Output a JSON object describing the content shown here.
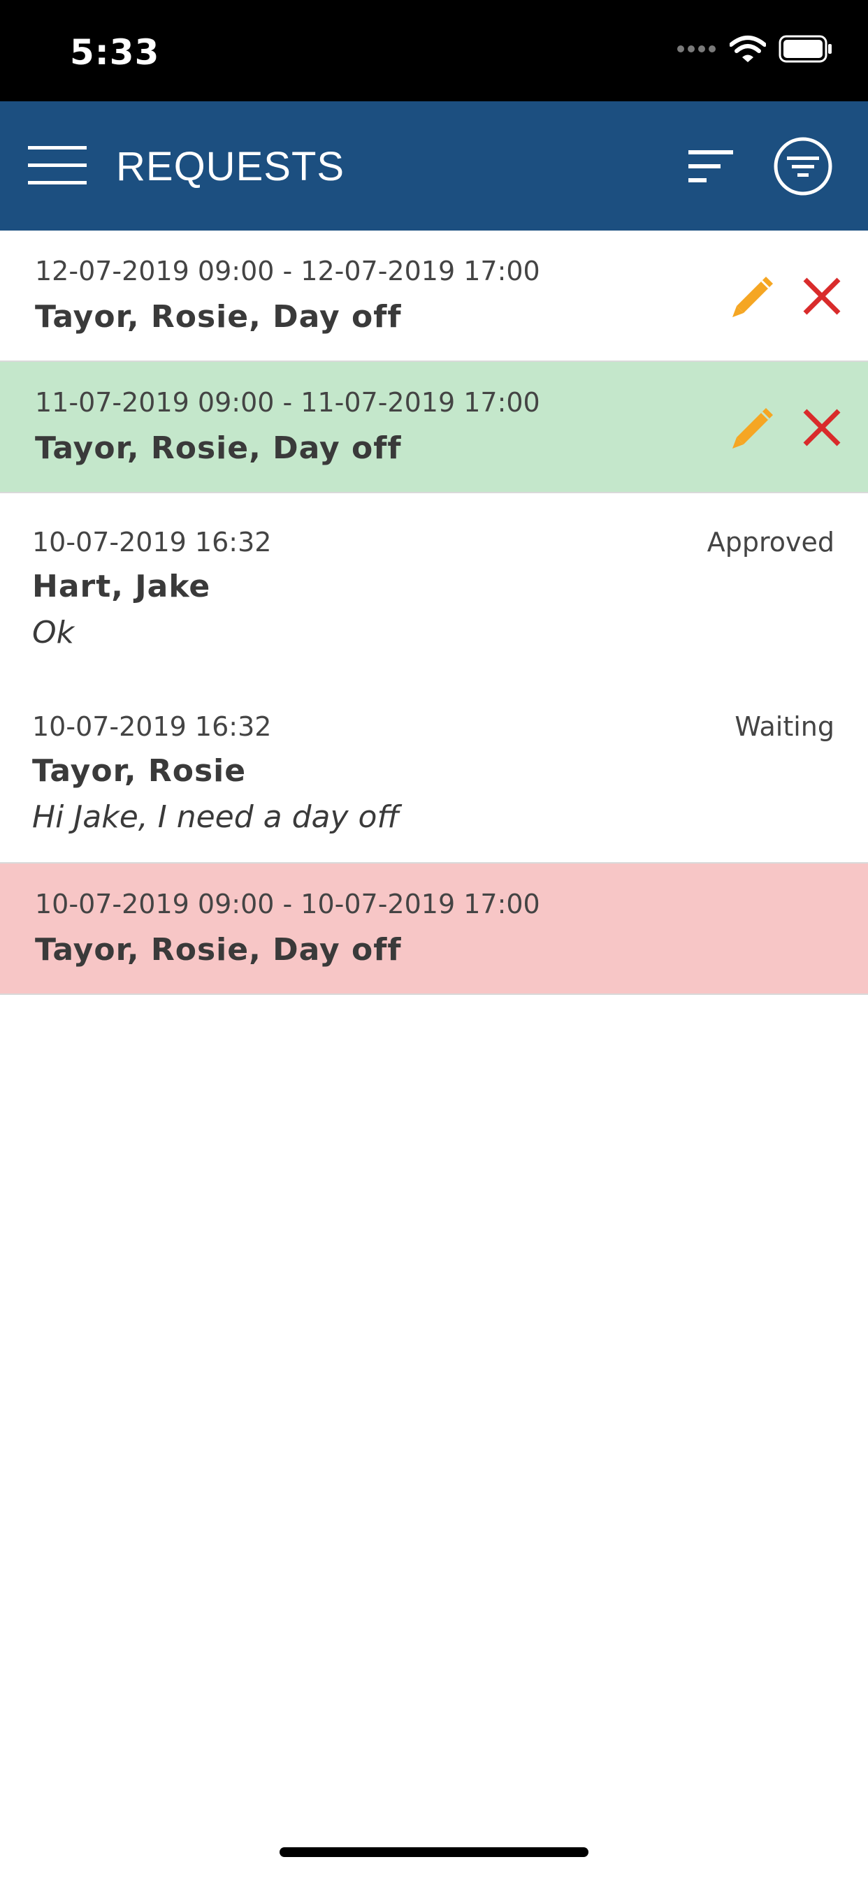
{
  "status_bar": {
    "time": "5:33"
  },
  "app_bar": {
    "title": "REQUESTS"
  },
  "colors": {
    "app_bar": "#1c4f80",
    "approved_row": "#c4e7cb",
    "rejected_row": "#f7c6c6",
    "edit_icon": "#f5a623",
    "delete_icon": "#d92b2b"
  },
  "requests": [
    {
      "date_range": "12-07-2019 09:00 - 12-07-2019 17:00",
      "title": "Tayor, Rosie, Day off"
    },
    {
      "date_range": "11-07-2019 09:00 - 11-07-2019 17:00",
      "title": "Tayor, Rosie, Day off"
    }
  ],
  "messages": [
    {
      "timestamp": "10-07-2019 16:32",
      "status": "Approved",
      "author": "Hart, Jake",
      "text": "Ok"
    },
    {
      "timestamp": "10-07-2019 16:32",
      "status": "Waiting",
      "author": "Tayor, Rosie",
      "text": "Hi Jake, I need a day off"
    }
  ],
  "past_request": {
    "date_range": "10-07-2019 09:00 - 10-07-2019 17:00",
    "title": "Tayor, Rosie, Day off"
  },
  "icons": {
    "menu": "hamburger-menu-icon",
    "sort": "sort-icon",
    "filter": "filter-circle-icon",
    "edit": "pencil-icon",
    "delete": "close-x-icon"
  }
}
